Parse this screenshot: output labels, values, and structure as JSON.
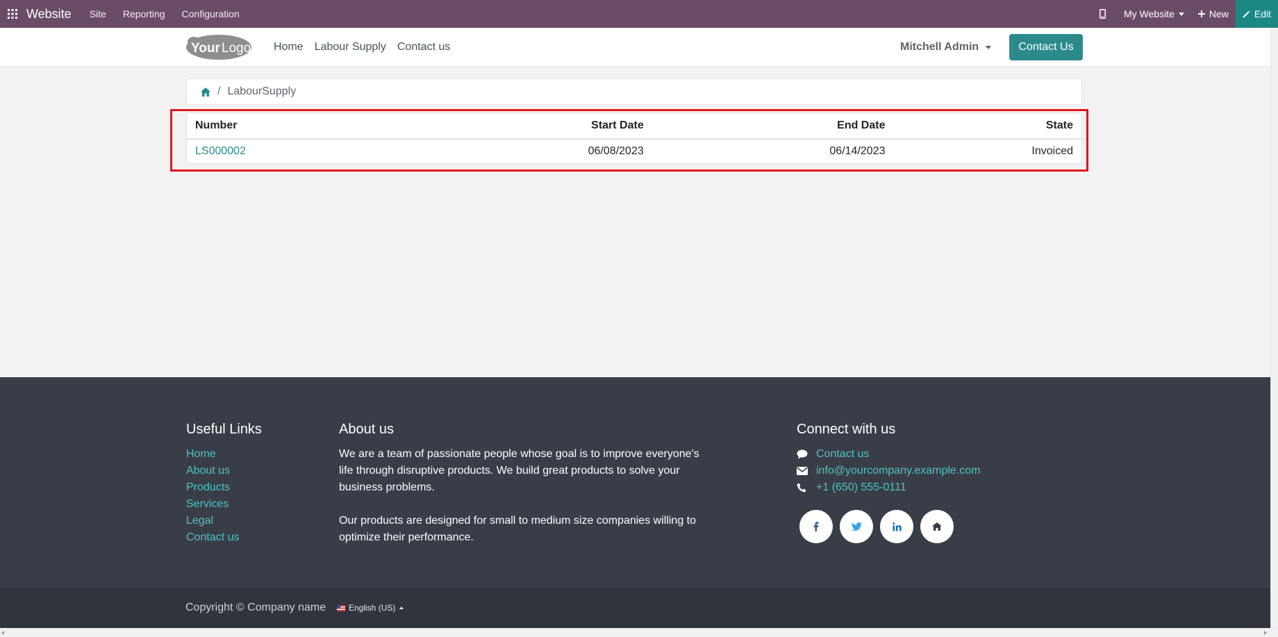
{
  "topbar": {
    "app_name": "Website",
    "menu": [
      "Site",
      "Reporting",
      "Configuration"
    ],
    "website_selector": "My Website",
    "new_label": "New",
    "edit_label": "Edit"
  },
  "header": {
    "logo_text": "YourLogo",
    "nav": [
      "Home",
      "Labour Supply",
      "Contact us"
    ],
    "user": "Mitchell Admin",
    "contact_button": "Contact Us"
  },
  "breadcrumb": {
    "separator": "/",
    "current": "LabourSupply"
  },
  "table": {
    "headers": [
      "Number",
      "Start Date",
      "End Date",
      "State"
    ],
    "rows": [
      {
        "number": "LS000002",
        "start_date": "06/08/2023",
        "end_date": "06/14/2023",
        "state": "Invoiced"
      }
    ]
  },
  "footer": {
    "useful_links": {
      "title": "Useful Links",
      "links": [
        "Home",
        "About us",
        "Products",
        "Services",
        "Legal",
        "Contact us"
      ]
    },
    "about": {
      "title": "About us",
      "paragraph1": "We are a team of passionate people whose goal is to improve everyone's life through disruptive products. We build great products to solve your business problems.",
      "paragraph2": "Our products are designed for small to medium size companies willing to optimize their performance."
    },
    "connect": {
      "title": "Connect with us",
      "contact": "Contact us",
      "email": "info@yourcompany.example.com",
      "phone": "+1 (650) 555-0111",
      "socials": [
        "facebook-icon",
        "twitter-icon",
        "linkedin-icon",
        "home-icon"
      ]
    },
    "copyright": "Copyright © Company name",
    "language": "English (US)"
  },
  "colors": {
    "topbar": "#6b4c67",
    "accent": "#2c8b8a",
    "footer": "#393d47",
    "highlight": "#e0161e"
  }
}
